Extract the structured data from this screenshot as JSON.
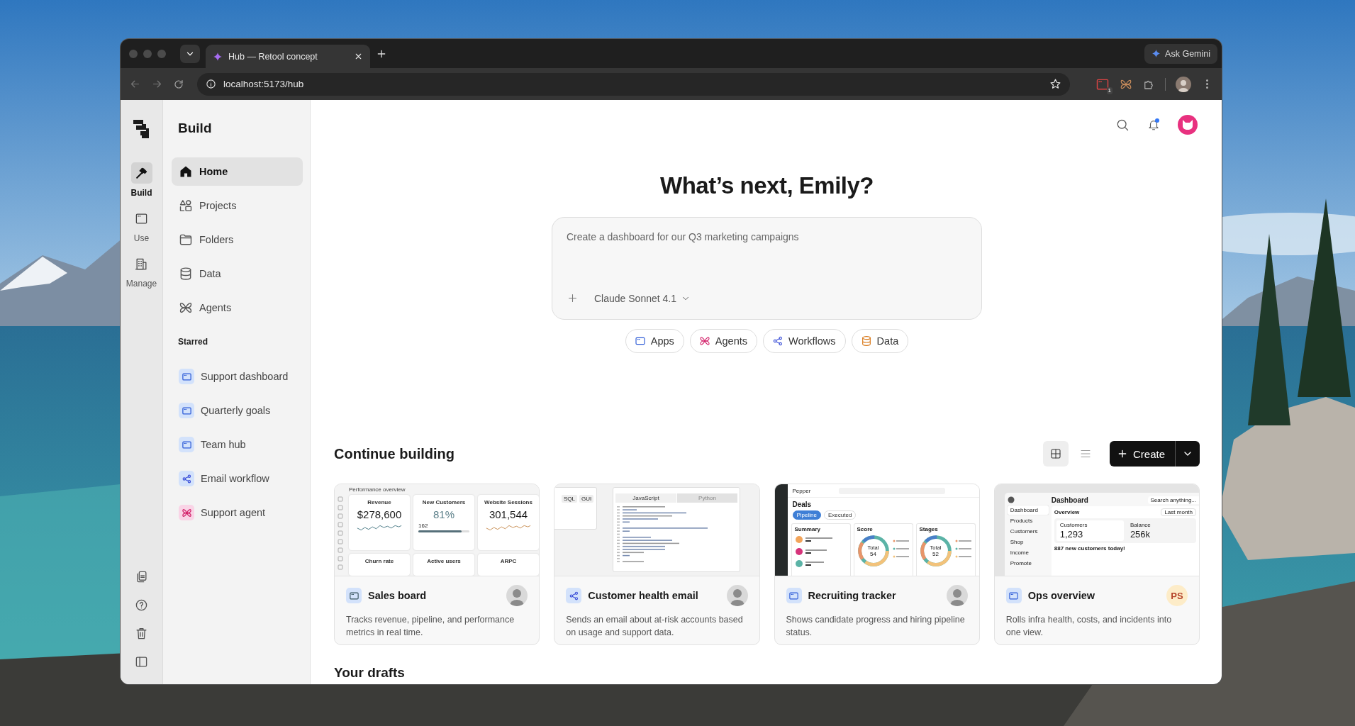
{
  "browser": {
    "tabs": [
      {
        "title": "Hub — Retool concept",
        "selected": true
      }
    ],
    "address": "localhost:5173/hub",
    "extension_badge": "1",
    "ask_button": "Ask Gemini"
  },
  "rail": {
    "items": [
      {
        "label": "Build",
        "selected": true
      },
      {
        "label": "Use",
        "selected": false
      },
      {
        "label": "Manage",
        "selected": false
      }
    ]
  },
  "sidebar": {
    "title": "Build",
    "nav": [
      {
        "label": "Home",
        "selected": true
      },
      {
        "label": "Projects",
        "selected": false
      },
      {
        "label": "Folders",
        "selected": false
      },
      {
        "label": "Data",
        "selected": false
      },
      {
        "label": "Agents",
        "selected": false
      }
    ],
    "starred_heading": "Starred",
    "starred": [
      {
        "label": "Support dashboard",
        "kind": "app"
      },
      {
        "label": "Quarterly goals",
        "kind": "app"
      },
      {
        "label": "Team hub",
        "kind": "app"
      },
      {
        "label": "Email workflow",
        "kind": "workflow"
      },
      {
        "label": "Support agent",
        "kind": "agent"
      }
    ]
  },
  "header": {
    "notifications_unread": true
  },
  "hero": {
    "title": "What’s next, Emily?",
    "prompt": {
      "placeholder": "Create a dashboard for our Q3 marketing campaigns",
      "model": "Claude Sonnet 4.1"
    },
    "chips": [
      {
        "label": "Apps",
        "kind": "app"
      },
      {
        "label": "Agents",
        "kind": "agent"
      },
      {
        "label": "Workflows",
        "kind": "workflow"
      },
      {
        "label": "Data",
        "kind": "data"
      }
    ]
  },
  "continue_building": {
    "title": "Continue building",
    "views": [
      {
        "kind": "grid",
        "selected": true
      },
      {
        "kind": "list",
        "selected": false
      }
    ],
    "create_button": "Create",
    "cards": [
      {
        "title": "Sales board",
        "kind": "app",
        "description": "Tracks revenue, pipeline, and performance metrics in real time.",
        "preview": {
          "kind": "metrics",
          "heading": "Performance overview",
          "tiles": [
            {
              "label": "Revenue",
              "value": "$278,600",
              "kind": "spark"
            },
            {
              "label": "New Customers",
              "value": "81%",
              "kind": "progress",
              "count": "162",
              "level": 0.85
            },
            {
              "label": "Website Sessions",
              "value": "301,544",
              "kind": "spark"
            },
            {
              "label": "Churn rate"
            },
            {
              "label": "Active users"
            },
            {
              "label": "ARPC"
            }
          ]
        }
      },
      {
        "title": "Customer health email",
        "kind": "workflow",
        "description": "Sends an email about at-risk accounts based on usage and support data.",
        "preview": {
          "kind": "code",
          "left_tabs": [
            "SQL",
            "GUI"
          ],
          "editor_tabs": [
            {
              "label": "JavaScript",
              "selected": true
            },
            {
              "label": "Python",
              "selected": false
            }
          ]
        }
      },
      {
        "title": "Recruiting tracker",
        "kind": "app",
        "description": "Shows candidate progress and hiring pipeline status.",
        "preview": {
          "kind": "deals",
          "brand": "Pepper",
          "heading": "Deals",
          "pills": [
            {
              "label": "Pipeline",
              "selected": true
            },
            {
              "label": "Executed",
              "selected": false
            }
          ],
          "panels": [
            {
              "title": "Summary",
              "kind": "list"
            },
            {
              "title": "Score",
              "kind": "donut",
              "center_label": "Total",
              "center_value": "54"
            },
            {
              "title": "Stages",
              "kind": "donut",
              "center_label": "Total",
              "center_value": "52"
            }
          ]
        }
      },
      {
        "title": "Ops overview",
        "kind": "app",
        "description": "Rolls infra health, costs, and incidents into one view.",
        "owner": {
          "kind": "initials",
          "initials": "PS"
        },
        "preview": {
          "kind": "dashboard",
          "heading": "Dashboard",
          "search": "Search anything...",
          "nav": [
            {
              "label": "Dashboard",
              "selected": true
            },
            {
              "label": "Products",
              "selected": false
            },
            {
              "label": "Customers",
              "selected": false
            },
            {
              "label": "Shop",
              "selected": false
            },
            {
              "label": "Income",
              "selected": false
            },
            {
              "label": "Promote",
              "selected": false
            }
          ],
          "panel_title": "Overview",
          "period": "Last month",
          "stats": [
            {
              "label": "Customers",
              "value": "1,293"
            },
            {
              "label": "Balance",
              "value": "256k"
            }
          ],
          "note": "887 new customers today!"
        }
      }
    ]
  },
  "drafts_title": "Your drafts"
}
